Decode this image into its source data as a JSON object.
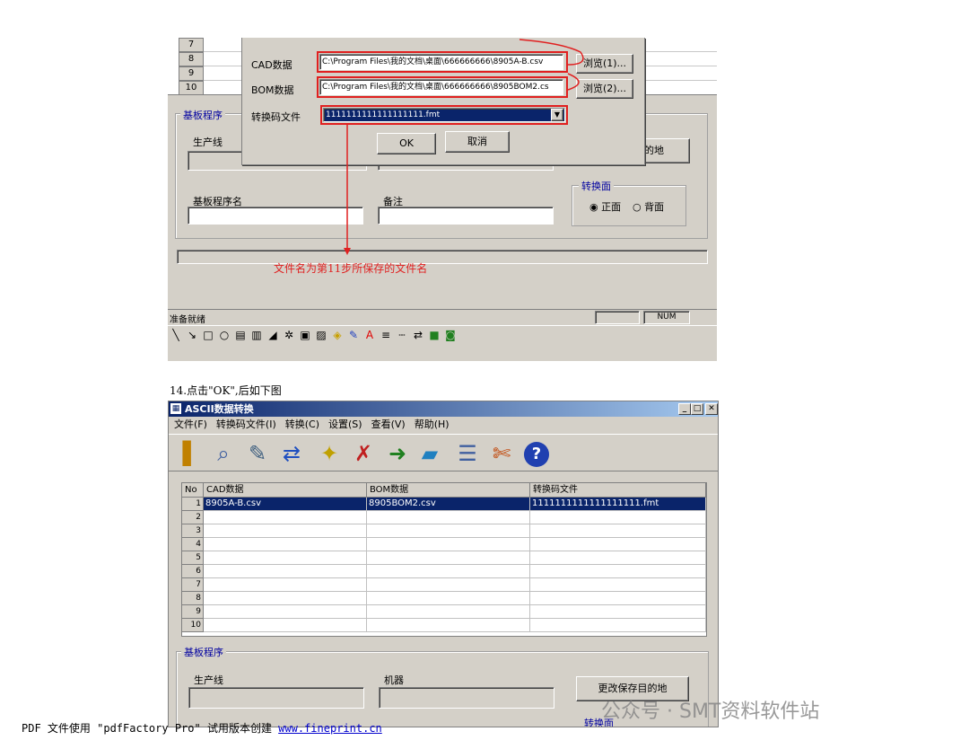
{
  "shot1": {
    "row_numbers": [
      "7",
      "8",
      "9",
      "10"
    ],
    "dialog": {
      "cad_label": "CAD数据",
      "cad_value": "C:\\Program Files\\我的文档\\桌面\\666666666\\8905A-B.csv",
      "cad_browse": "浏览(1)...",
      "bom_label": "BOM数据",
      "bom_value": "C:\\Program Files\\我的文档\\桌面\\666666666\\8905BOM2.cs",
      "bom_browse": "浏览(2)...",
      "fmt_label": "转换码文件",
      "fmt_value": "1111111111111111111.fmt",
      "ok": "OK",
      "cancel": "取消"
    },
    "group_title": "基板程序",
    "line_label": "生产线",
    "program_label": "基板程序名",
    "remark_label": "备注",
    "save_dest_btn": "的地",
    "face_group": "转换面",
    "face_front": "正面",
    "face_back": "背面",
    "annotation": "文件名为第11步所保存的文件名",
    "status_text": "准备就绪",
    "status_num": "NUM"
  },
  "caption": "14.点击\"OK\",后如下图",
  "shot2": {
    "title": "ASCII数据转换",
    "menu": [
      "文件(F)",
      "转换码文件(I)",
      "转换(C)",
      "设置(S)",
      "查看(V)",
      "帮助(H)"
    ],
    "headers": [
      "No",
      "CAD数据",
      "BOM数据",
      "转换码文件"
    ],
    "rows": [
      {
        "no": "1",
        "cad": "8905A-B.csv",
        "bom": "8905BOM2.csv",
        "fmt": "1111111111111111111.fmt"
      },
      {
        "no": "2",
        "cad": "",
        "bom": "",
        "fmt": ""
      },
      {
        "no": "3",
        "cad": "",
        "bom": "",
        "fmt": ""
      },
      {
        "no": "4",
        "cad": "",
        "bom": "",
        "fmt": ""
      },
      {
        "no": "5",
        "cad": "",
        "bom": "",
        "fmt": ""
      },
      {
        "no": "6",
        "cad": "",
        "bom": "",
        "fmt": ""
      },
      {
        "no": "7",
        "cad": "",
        "bom": "",
        "fmt": ""
      },
      {
        "no": "8",
        "cad": "",
        "bom": "",
        "fmt": ""
      },
      {
        "no": "9",
        "cad": "",
        "bom": "",
        "fmt": ""
      },
      {
        "no": "10",
        "cad": "",
        "bom": "",
        "fmt": ""
      }
    ],
    "group_title": "基板程序",
    "line_label": "生产线",
    "machine_label": "机器",
    "save_dest_btn": "更改保存目的地",
    "face_group": "转换面"
  },
  "footer": {
    "text": "PDF 文件使用 \"pdfFactory Pro\" 试用版本创建 ",
    "link": "www.fineprint.cn"
  },
  "watermark": "公众号 · SMT资料软件站"
}
